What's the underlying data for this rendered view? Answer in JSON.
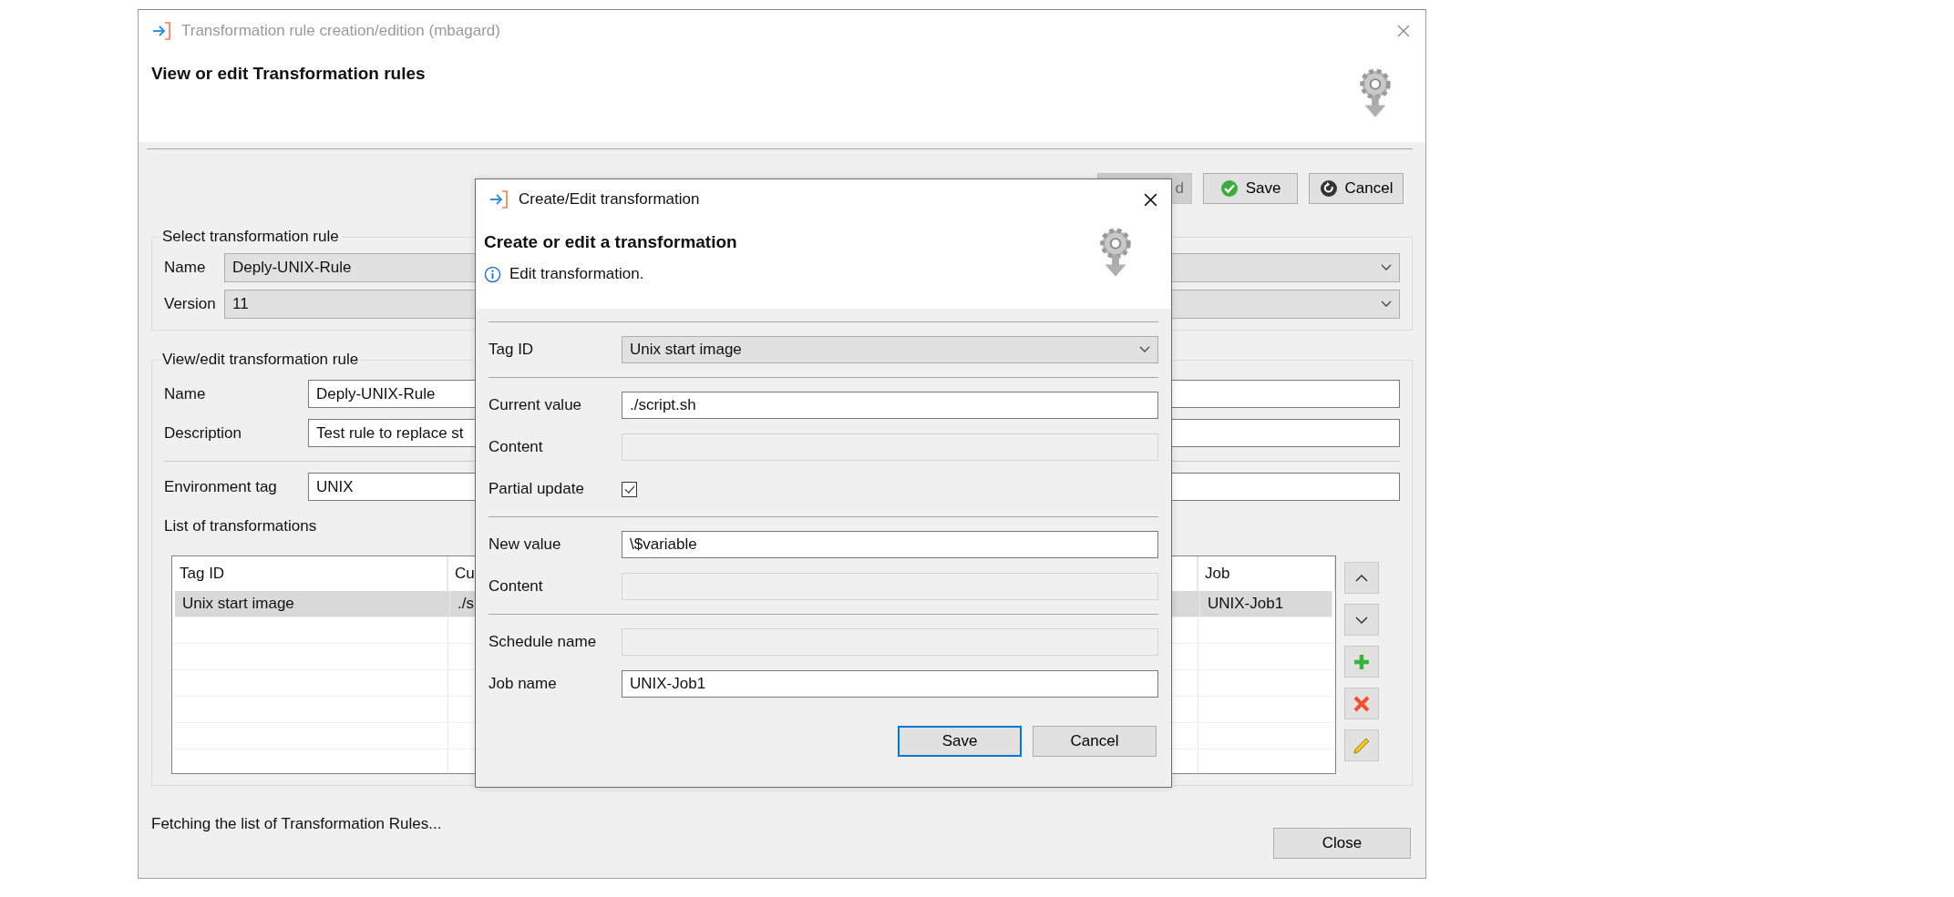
{
  "window": {
    "title": "Transformation rule creation/edition (mbagard)",
    "heading": "View or edit Transformation rules"
  },
  "toolbar": [
    {
      "label": "d",
      "disabled": true
    },
    {
      "label": "Save",
      "disabled": false
    },
    {
      "label": "Cancel",
      "disabled": false
    }
  ],
  "select_group": {
    "legend": "Select transformation rule",
    "fields": [
      {
        "label": "Name",
        "value": "Deply-UNIX-Rule",
        "kind": "combo"
      },
      {
        "label": "Version",
        "value": "11",
        "kind": "combo"
      }
    ]
  },
  "edit_group": {
    "legend": "View/edit transformation rule",
    "fields": [
      {
        "label": "Name",
        "value": "Deply-UNIX-Rule"
      },
      {
        "label": "Description",
        "value": "Test rule to replace st"
      }
    ],
    "env_field": {
      "label": "Environment tag",
      "value": "UNIX"
    },
    "list_label": "List of transformations",
    "table": {
      "columns": [
        "Tag ID",
        "Cu",
        "Job"
      ],
      "rows": [
        {
          "cells": [
            "Unix start image",
            "./s",
            "UNIX-Job1"
          ],
          "selected": true
        }
      ]
    }
  },
  "status": "Fetching the list of Transformation Rules...",
  "close_button": "Close",
  "dialog": {
    "title": "Create/Edit transformation",
    "heading": "Create or edit a transformation",
    "info": "Edit transformation.",
    "groups": [
      [
        {
          "label": "Tag ID",
          "value": "Unix start image",
          "kind": "combo",
          "disabled": false
        }
      ],
      [
        {
          "label": "Current value",
          "value": "./script.sh",
          "kind": "text",
          "disabled": false
        },
        {
          "label": "Content",
          "kind": "text",
          "disabled": true
        },
        {
          "label": "Partial update",
          "kind": "checkbox",
          "checked": true
        }
      ],
      [
        {
          "label": "New value",
          "value": "\\$variable",
          "kind": "text",
          "disabled": false
        },
        {
          "label": "Content",
          "kind": "text",
          "disabled": true
        }
      ],
      [
        {
          "label": "Schedule name",
          "kind": "text",
          "disabled": true
        },
        {
          "label": "Job name",
          "value": "UNIX-Job1",
          "kind": "text",
          "disabled": false
        }
      ]
    ],
    "buttons": [
      {
        "label": "Save",
        "focused": true
      },
      {
        "label": "Cancel",
        "focused": false
      }
    ]
  }
}
